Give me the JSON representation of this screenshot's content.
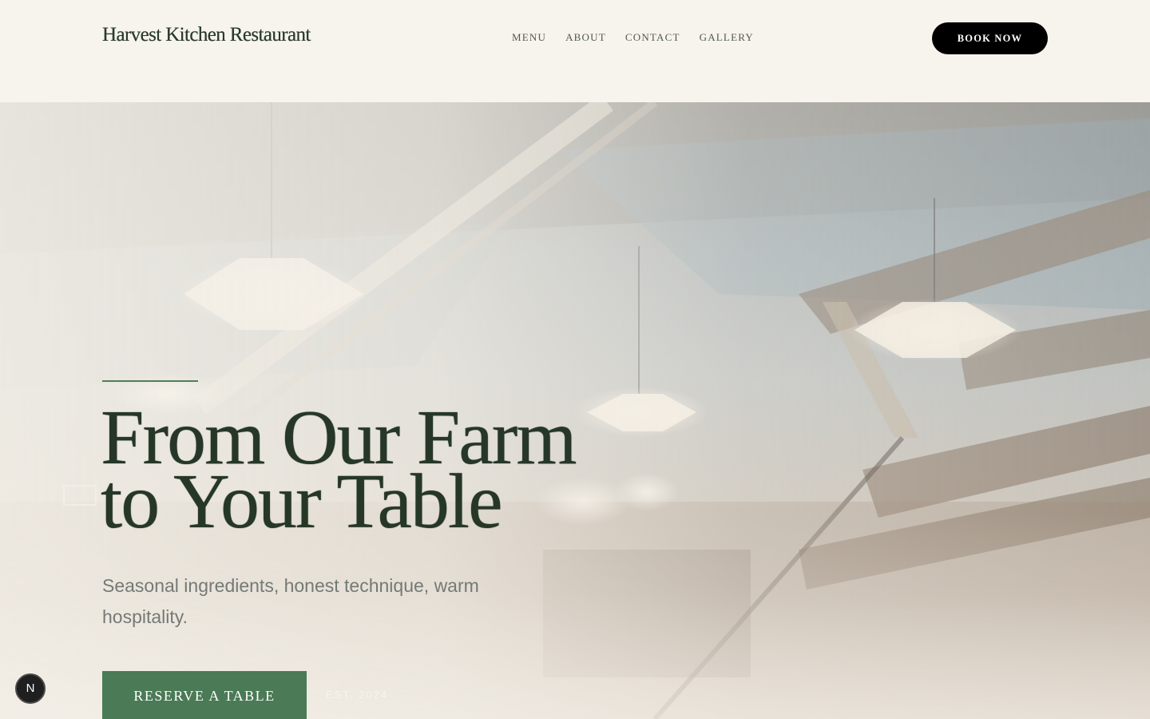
{
  "header": {
    "brand": "Harvest Kitchen Restaurant",
    "nav": [
      {
        "label": "MENU"
      },
      {
        "label": "ABOUT"
      },
      {
        "label": "CONTACT"
      },
      {
        "label": "GALLERY"
      }
    ],
    "cta_label": "BOOK NOW"
  },
  "hero": {
    "title_line1": "From Our Farm",
    "title_line2": "to Your Table",
    "subtitle": "Seasonal ingredients, honest technique, warm hospitality.",
    "cta_label": "RESERVE A TABLE",
    "est_text": "EST. 2024",
    "accent_color": "#4a7a56",
    "title_color": "#263727"
  },
  "badge": {
    "label": "N",
    "icon": "next-logo-icon"
  }
}
